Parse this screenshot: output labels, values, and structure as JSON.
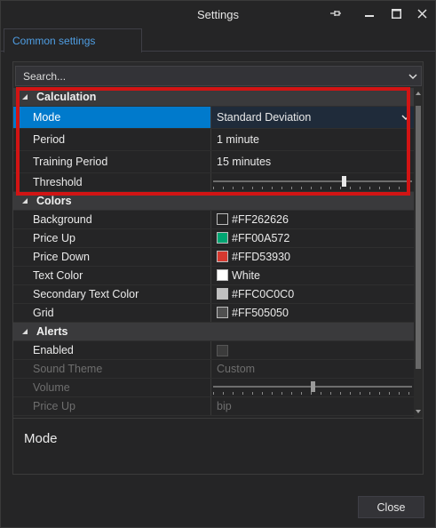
{
  "window": {
    "title": "Settings"
  },
  "tabs": [
    {
      "label": "Common settings"
    }
  ],
  "search": {
    "placeholder": "Search..."
  },
  "categories": {
    "calculation": {
      "label": "Calculation",
      "rows": [
        {
          "name": "Mode",
          "value": "Standard Deviation"
        },
        {
          "name": "Period",
          "value": "1 minute"
        },
        {
          "name": "Training Period",
          "value": "15 minutes"
        },
        {
          "name": "Threshold",
          "slider_level": 0.66
        }
      ]
    },
    "colors": {
      "label": "Colors",
      "rows": [
        {
          "name": "Background",
          "value": "#FF262626",
          "swatch": "#262626"
        },
        {
          "name": "Price Up",
          "value": "#FF00A572",
          "swatch": "#00a572"
        },
        {
          "name": "Price Down",
          "value": "#FFD53930",
          "swatch": "#d53930"
        },
        {
          "name": "Text Color",
          "value": "White",
          "swatch": "#ffffff"
        },
        {
          "name": "Secondary Text Color",
          "value": "#FFC0C0C0",
          "swatch": "#c0c0c0"
        },
        {
          "name": "Grid",
          "value": "#FF505050",
          "swatch": "#505050"
        }
      ]
    },
    "alerts": {
      "label": "Alerts",
      "rows": [
        {
          "name": "Enabled",
          "checked": false
        },
        {
          "name": "Sound Theme",
          "value": "Custom"
        },
        {
          "name": "Volume",
          "slider_level": 0.5
        },
        {
          "name": "Price Up",
          "value": "bip"
        }
      ]
    }
  },
  "description": {
    "title": "Mode"
  },
  "footer": {
    "close_label": "Close"
  },
  "accent": {
    "selection": "#007acc",
    "highlight_box": "#d21414",
    "tab_text": "#4f9ee3"
  }
}
